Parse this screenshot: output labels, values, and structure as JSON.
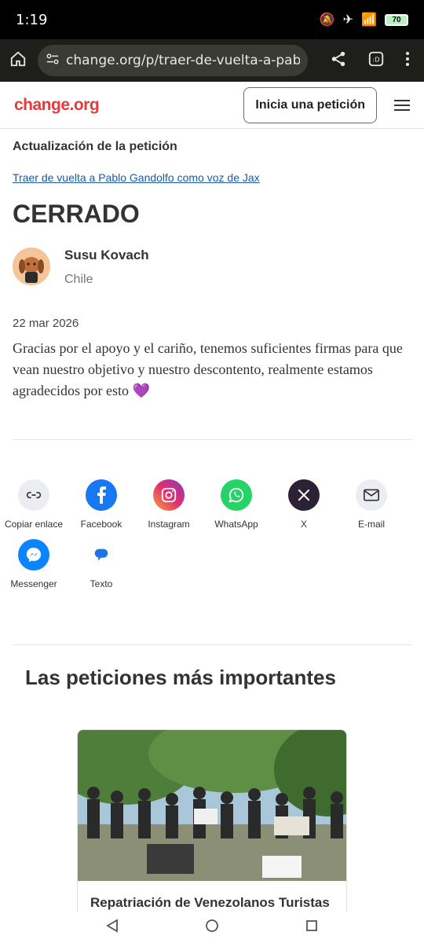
{
  "status": {
    "time": "1:19",
    "battery": "70"
  },
  "browser": {
    "url": "change.org/p/traer-de-vuelta-a-pablo-gandolfo"
  },
  "header": {
    "logo": "change.org",
    "start_button": "Inicia una petición"
  },
  "update": {
    "label": "Actualización de la petición",
    "petition_link": "Traer de vuelta a Pablo Gandolfo como voz de Jax",
    "status_title": "CERRADO",
    "author_name": "Susu Kovach",
    "author_country": "Chile",
    "date": "22 mar 2026",
    "body": "Gracias por el apoyo y el cariño, tenemos suficientes firmas para que vean nuestro objetivo y nuestro descontento, realmente estamos agradecidos por esto 💜"
  },
  "share": {
    "items": [
      {
        "label": "Copiar enlace",
        "icon": "link-icon",
        "color": "#eaeaf2"
      },
      {
        "label": "Facebook",
        "icon": "facebook-icon",
        "color": "#1877f2"
      },
      {
        "label": "Instagram",
        "icon": "instagram-icon",
        "color": "#e1306c"
      },
      {
        "label": "WhatsApp",
        "icon": "whatsapp-icon",
        "color": "#25d366"
      },
      {
        "label": "X",
        "icon": "x-icon",
        "color": "#2d2235"
      },
      {
        "label": "E-mail",
        "icon": "mail-icon",
        "color": "#eaeaf2"
      },
      {
        "label": "Messenger",
        "icon": "messenger-icon",
        "color": "#0a84ff"
      },
      {
        "label": "Texto",
        "icon": "message-icon",
        "color": "#ffffff"
      }
    ]
  },
  "top_petitions": {
    "title": "Las peticiones más importantes",
    "card_title": "Repatriación de Venezolanos Turistas"
  }
}
